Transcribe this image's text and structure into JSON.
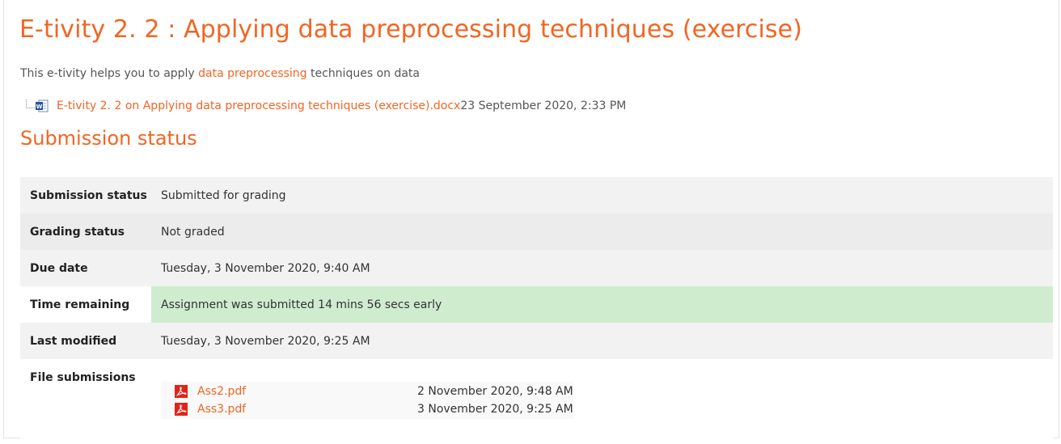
{
  "page": {
    "title": "E-tivity 2. 2 : Applying data preprocessing techniques (exercise)",
    "intro_prefix": "This e-tivity helps you to apply ",
    "intro_link": "data preprocessing",
    "intro_suffix": " techniques on data"
  },
  "attachment": {
    "icon": "word-doc-icon",
    "filename": "E-tivity 2. 2 on Applying data preprocessing techniques (exercise).docx",
    "timestamp": "23 September 2020, 2:33 PM"
  },
  "submission": {
    "heading": "Submission status",
    "rows": [
      {
        "label": "Submission status",
        "value": "Submitted for grading"
      },
      {
        "label": "Grading status",
        "value": "Not graded"
      },
      {
        "label": "Due date",
        "value": "Tuesday, 3 November 2020, 9:40 AM"
      },
      {
        "label": "Time remaining",
        "value": "Assignment was submitted 14 mins 56 secs early"
      },
      {
        "label": "Last modified",
        "value": "Tuesday, 3 November 2020, 9:25 AM"
      },
      {
        "label": "File submissions"
      }
    ],
    "files": [
      {
        "name": "Ass2.pdf",
        "date": "2 November 2020, 9:48 AM",
        "icon": "pdf-icon"
      },
      {
        "name": "Ass3.pdf",
        "date": "3 November 2020, 9:25 AM",
        "icon": "pdf-icon"
      }
    ]
  },
  "colors": {
    "accent": "#f26522",
    "success_bg": "#cfeccf"
  }
}
